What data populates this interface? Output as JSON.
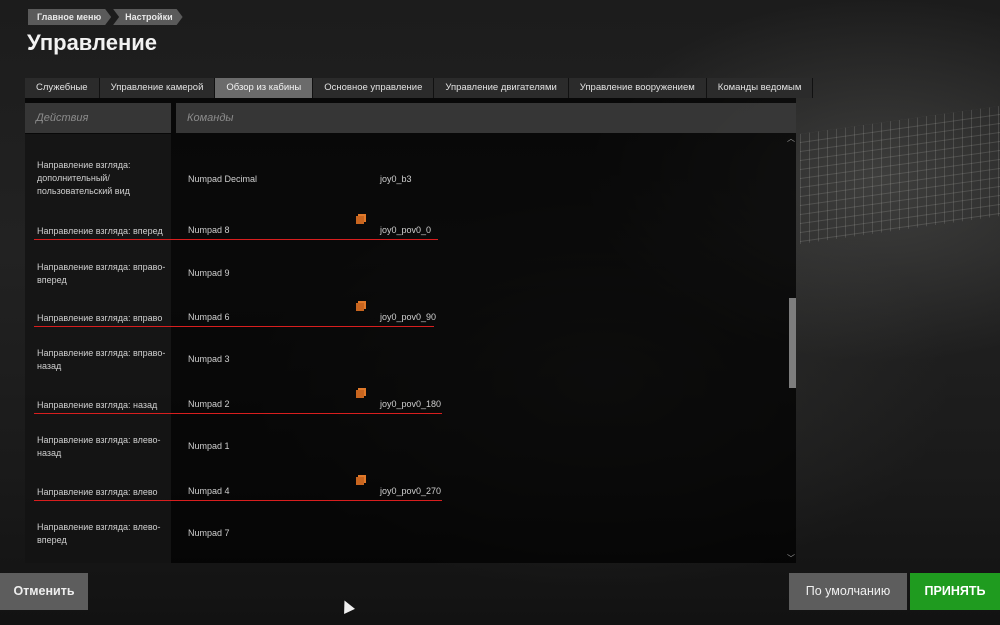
{
  "breadcrumb": [
    "Главное меню",
    "Настройки"
  ],
  "page_title": "Управление",
  "tabs": [
    {
      "label": "Служебные",
      "active": false
    },
    {
      "label": "Управление камерой",
      "active": false
    },
    {
      "label": "Обзор из кабины",
      "active": true
    },
    {
      "label": "Основное управление",
      "active": false
    },
    {
      "label": "Управление двигателями",
      "active": false
    },
    {
      "label": "Управление вооружением",
      "active": false
    },
    {
      "label": "Команды ведомым",
      "active": false
    }
  ],
  "columns": {
    "actions": "Действия",
    "commands": "Команды"
  },
  "rows": [
    {
      "action": "Направление взгляда: дополнительный/пользовательский вид",
      "key1": "Numpad Decimal",
      "key2": "joy0_b3",
      "conflict": false
    },
    {
      "action": "Направление взгляда: вперед",
      "key1": "Numpad 8",
      "key2": "joy0_pov0_0",
      "conflict": true
    },
    {
      "action": "Направление взгляда: вправо-вперед",
      "key1": "Numpad 9",
      "key2": "",
      "conflict": false
    },
    {
      "action": "Направление взгляда: вправо",
      "key1": "Numpad 6",
      "key2": "joy0_pov0_90",
      "conflict": true
    },
    {
      "action": "Направление взгляда: вправо-назад",
      "key1": "Numpad 3",
      "key2": "",
      "conflict": false
    },
    {
      "action": "Направление взгляда: назад",
      "key1": "Numpad 2",
      "key2": "joy0_pov0_180",
      "conflict": true
    },
    {
      "action": "Направление взгляда: влево-назад",
      "key1": "Numpad 1",
      "key2": "",
      "conflict": false
    },
    {
      "action": "Направление взгляда: влево",
      "key1": "Numpad 4",
      "key2": "joy0_pov0_270",
      "conflict": true
    },
    {
      "action": "Направление взгляда: влево-вперед",
      "key1": "Numpad 7",
      "key2": "",
      "conflict": false
    }
  ],
  "buttons": {
    "cancel": "Отменить",
    "default": "По умолчанию",
    "accept": "ПРИНЯТЬ"
  },
  "icons": {
    "conflict": "conflict-icon",
    "scroll_up": "chevron-up-icon",
    "scroll_down": "chevron-down-icon",
    "cursor": "mouse-cursor-icon"
  },
  "colors": {
    "accept": "#1f9b1f",
    "conflict_line": "#d81e1e",
    "conflict_icon": "#c8651f"
  }
}
